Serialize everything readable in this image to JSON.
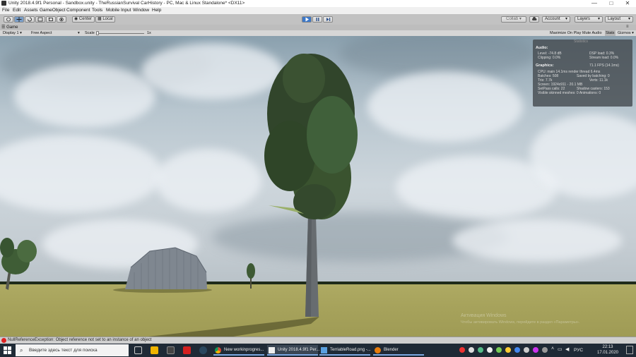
{
  "window": {
    "title": "Unity 2018.4.9f1 Personal - Sandbox.unity - TheRussianSurvival CarHistory - PC, Mac & Linux Standalone* <DX11>",
    "minimize": "—",
    "maximize": "□",
    "close": "✕"
  },
  "menu": [
    "File",
    "Edit",
    "Assets",
    "GameObject",
    "Component",
    "Tools",
    "Mobile Input",
    "Window",
    "Help"
  ],
  "toolbar": {
    "pivot": "Center",
    "space": "Local",
    "collab": "Collab ▾",
    "cloud_icon": "cloud-icon",
    "account": "Account",
    "layers": "Layers",
    "layout": "Layout"
  },
  "game_tab": {
    "label": "Game",
    "display": "Display 1",
    "aspect": "Free Aspect",
    "scale_label": "Scale",
    "scale_value": "1x",
    "maximize_on_play": "Maximize On Play",
    "mute_audio": "Mute Audio",
    "stats": "Stats",
    "gizmos": "Gizmos ▾"
  },
  "stats": {
    "title": "Statistics",
    "audio_header": "Audio:",
    "level": "Level: -74.8 dB",
    "clipping": "Clipping: 0.0%",
    "dsp_load": "DSP load: 0.3%",
    "stream_load": "Stream load: 0.0%",
    "graphics_header": "Graphics:",
    "fps": "71.1 FPS (14.1ms)",
    "cpu": "CPU: main 14.1ms   render thread 6.4ms",
    "batches": "Batches: 508",
    "saved_batching": "Saved by batching: 0",
    "tris": "Tris: 7.7k",
    "verts": "Verts: 11.1k",
    "screen": "Screen: 1924x911 - 20.1 MB",
    "setpass": "SetPass calls: 22",
    "shadow_casters": "Shadow casters: 153",
    "skinned": "Visible skinned meshes: 0   Animations: 0"
  },
  "watermark": {
    "line1": "Активация Windows",
    "line2": "Чтобы активировать Windows, перейдите в раздел «Параметры»."
  },
  "status_bar": {
    "message": "NullReferenceException: Object reference not set to an instance of an object"
  },
  "taskbar": {
    "search_placeholder": "Введите здесь текст для поиска",
    "apps": [
      {
        "label": "New workinprogres..."
      },
      {
        "label": "Unity 2018.4.9f1 Per..."
      },
      {
        "label": "TerriableRoad.png -..."
      },
      {
        "label": "Blender"
      }
    ],
    "lang": "РУС",
    "time": "22:13",
    "date": "17.01.2020"
  },
  "colors": {
    "play_active": "#3d78c8",
    "error": "#dd2222",
    "taskbar": "#1f2a36"
  }
}
